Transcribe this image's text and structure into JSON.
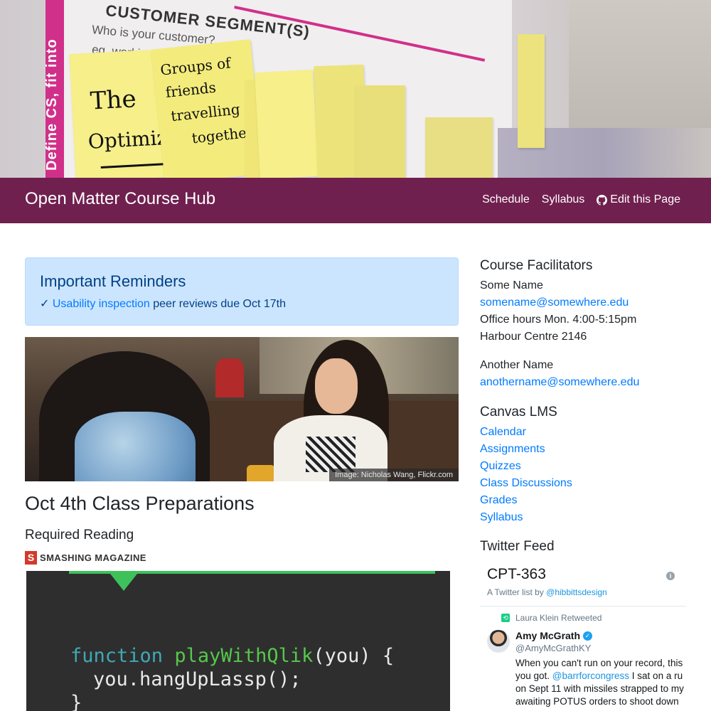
{
  "hero": {
    "segment_title": "CUSTOMER SEGMENT(S)",
    "segment_question": "Who is your customer?",
    "segment_example": "eg. working par",
    "stripe_text": "Define CS, fit into",
    "note1_line1": "The",
    "note1_line2": "Optimizer",
    "note2_line1": "Groups of",
    "note2_line2": "friends",
    "note2_line3": "travelling",
    "note2_line4": "together"
  },
  "navbar": {
    "brand": "Open Matter Course Hub",
    "links": [
      {
        "label": "Schedule"
      },
      {
        "label": "Syllabus"
      },
      {
        "label": "Edit this Page"
      }
    ],
    "colors": {
      "background": "#70204f"
    }
  },
  "alert": {
    "title": "Important Reminders",
    "check": "✓",
    "link_text": "Usability inspection",
    "rest_text": " peer reviews due Oct 17th"
  },
  "photo": {
    "credit": "Image: Nicholas Wang, Flickr.com"
  },
  "main": {
    "prep_heading": "Oct 4th Class Preparations",
    "reading_heading": "Required Reading",
    "magazine_logo": "S",
    "magazine_name": "SMASHING MAGAZINE",
    "code": {
      "kw": "function",
      "fn": "playWithQlik",
      "rest1": "(you) {",
      "line2": "you.hangUpLassp();",
      "line3": "}"
    }
  },
  "sidebar": {
    "facilitators_heading": "Course Facilitators",
    "facilitator1": {
      "name": "Some Name",
      "email": "somename@somewhere.edu",
      "hours": "Office hours Mon. 4:00-5:15pm",
      "room": "Harbour Centre 2146"
    },
    "facilitator2": {
      "name": "Another Name",
      "email": "anothername@somewhere.edu"
    },
    "canvas_heading": "Canvas LMS",
    "canvas_links": [
      "Calendar",
      "Assignments",
      "Quizzes",
      "Class Discussions",
      "Grades",
      "Syllabus"
    ],
    "twitter_heading": "Twitter Feed"
  },
  "twitter": {
    "list_title": "CPT-363",
    "info": "i",
    "sub_prefix": "A Twitter list by ",
    "sub_handle": "@hibbittsdesign",
    "retweeted_by": "Laura Klein Retweeted",
    "author_name": "Amy McGrath",
    "verified_mark": "✓",
    "author_handle": "@AmyMcGrathKY",
    "body_line1": "When you can't run on your record, this",
    "body_line2_pre": "you got. ",
    "body_line2_link": "@barrforcongress",
    "body_line2_post": " I sat on a ru",
    "body_line3": "on Sept 11 with missiles strapped to my",
    "body_line4": "awaiting POTUS orders to shoot down"
  },
  "colors": {
    "link": "#007bff",
    "alert_bg": "#cce5ff",
    "alert_text": "#004085",
    "twitter_link": "#1b95e0"
  }
}
